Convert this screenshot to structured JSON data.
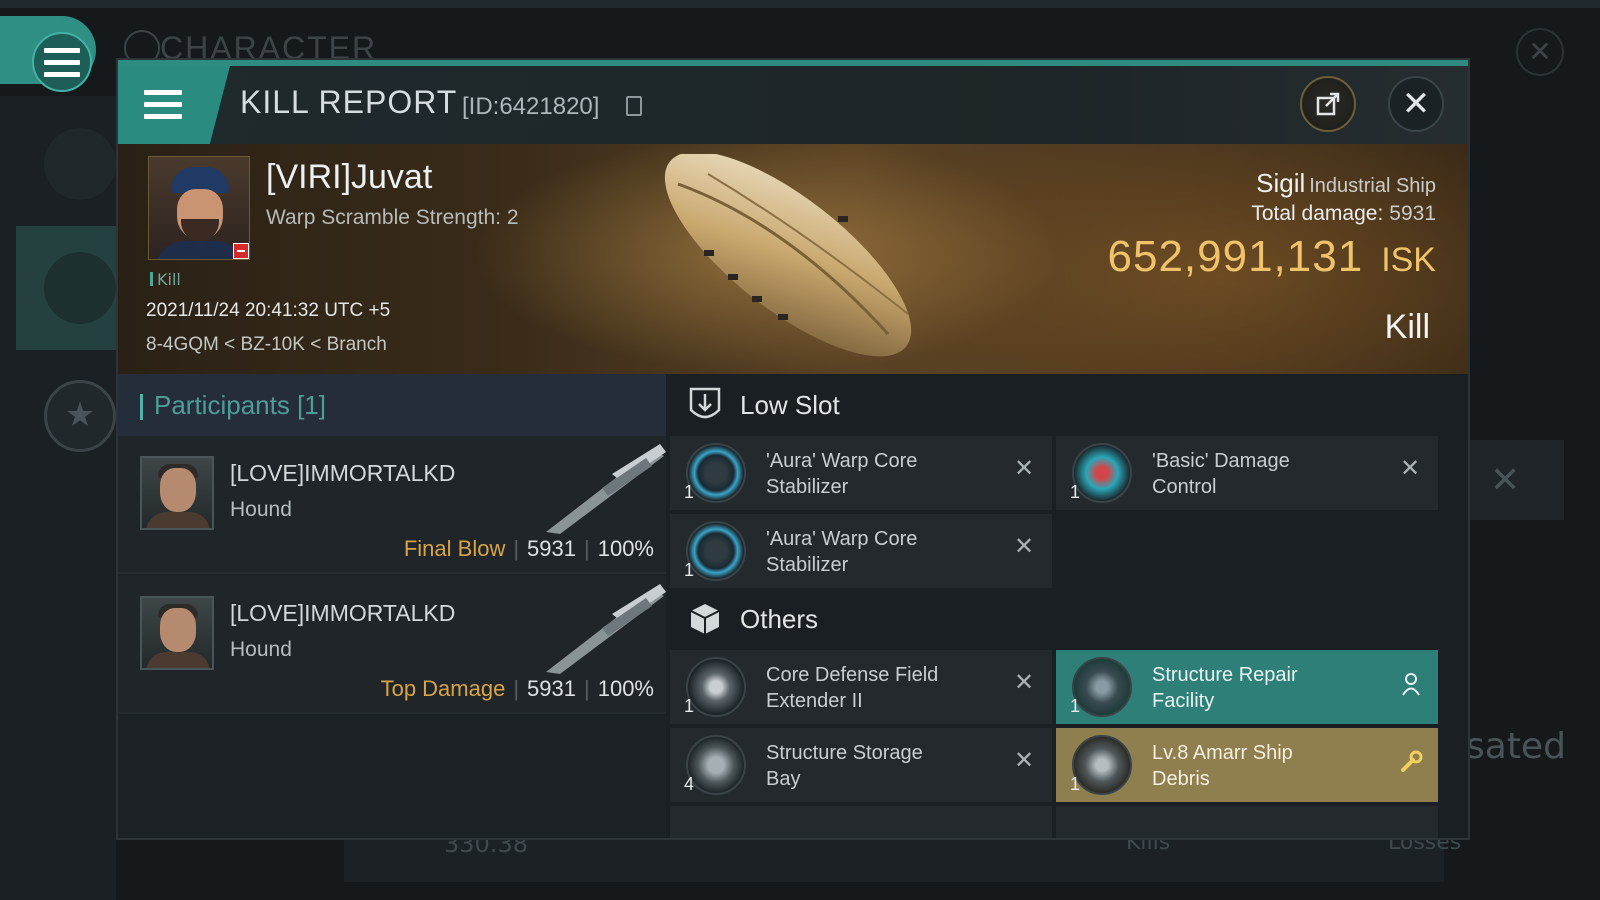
{
  "background": {
    "title": "CHARACTER",
    "right_text": "sated",
    "bottom_value": "330.38",
    "bottom_kills": "Kills",
    "bottom_losses": "Losses"
  },
  "header": {
    "title": "KILL REPORT",
    "report_id": "[ID:6421820]"
  },
  "victim": {
    "name": "[VIRI]Juvat",
    "warp_scramble": "Warp Scramble Strength: 2",
    "tag": "Kill",
    "time": "2021/11/24 20:41:32 UTC +5",
    "location": "8-4GQM < BZ-10K < Branch"
  },
  "ship": {
    "name": "Sigil",
    "class": "Industrial Ship",
    "total_damage_label": "Total damage:",
    "total_damage": "5931",
    "isk_value": "652,991,131",
    "isk_unit": "ISK",
    "kill_type": "Kill"
  },
  "participants": {
    "title": "Participants [1]",
    "items": [
      {
        "name": "[LOVE]IMMORTALKD",
        "ship": "Hound",
        "role": "Final Blow",
        "damage": "5931",
        "percent": "100%"
      },
      {
        "name": "[LOVE]IMMORTALKD",
        "ship": "Hound",
        "role": "Top Damage",
        "damage": "5931",
        "percent": "100%"
      }
    ]
  },
  "fittings": {
    "low_slot": {
      "title": "Low Slot",
      "items": [
        {
          "name_line1": "'Aura' Warp Core",
          "name_line2": "Stabilizer",
          "qty": "1"
        },
        {
          "name_line1": "'Basic' Damage",
          "name_line2": "Control",
          "qty": "1"
        },
        {
          "name_line1": "'Aura' Warp Core",
          "name_line2": "Stabilizer",
          "qty": "1"
        }
      ]
    },
    "others": {
      "title": "Others",
      "items": [
        {
          "name_line1": "Core Defense Field",
          "name_line2": "Extender II",
          "qty": "1"
        },
        {
          "name_line1": "Structure Repair",
          "name_line2": "Facility",
          "qty": "1"
        },
        {
          "name_line1": "Structure Storage",
          "name_line2": "Bay",
          "qty": "4"
        },
        {
          "name_line1": "Lv.8 Amarr Ship",
          "name_line2": "Debris",
          "qty": "1"
        }
      ]
    }
  },
  "colors": {
    "accent_teal": "#2e8b80",
    "isk_gold": "#f0c36a",
    "final_blow": "#d9a347",
    "dropped_teal": "#2d7f77",
    "debris_gold": "#8f7e4e"
  },
  "icons": {
    "menu": "hamburger-icon",
    "share": "share-icon",
    "close": "close-icon",
    "low_slot": "low-slot-icon",
    "others": "cargo-box-icon",
    "remove": "x-icon",
    "person": "person-icon",
    "wrench": "wrench-icon"
  }
}
